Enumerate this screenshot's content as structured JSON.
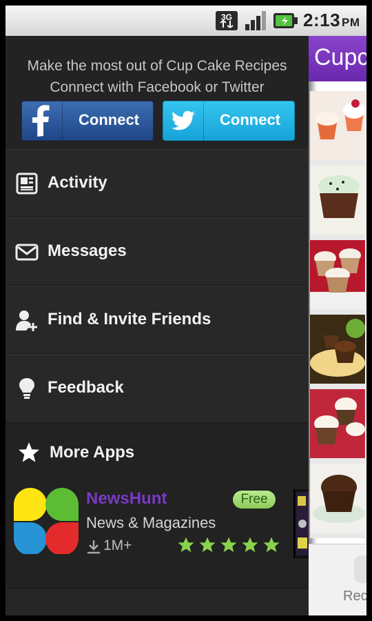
{
  "status_bar": {
    "network": "3G",
    "time": "2:13",
    "ampm": "PM"
  },
  "drawer": {
    "promo_line1": "Make the most out of Cup Cake Recipes",
    "promo_line2": "Connect with Facebook or Twitter",
    "facebook_button": "Connect",
    "twitter_button": "Connect",
    "menu": [
      {
        "label": "Activity",
        "icon": "newspaper-icon"
      },
      {
        "label": "Messages",
        "icon": "envelope-icon"
      },
      {
        "label": "Find & Invite Friends",
        "icon": "add-friend-icon"
      },
      {
        "label": "Feedback",
        "icon": "lightbulb-icon"
      }
    ],
    "more_apps": {
      "label": "More Apps",
      "app": {
        "name": "NewsHunt",
        "badge": "Free",
        "category": "News & Magazines",
        "downloads": "1M+",
        "rating": 5,
        "colors": {
          "name": "#7b39c6",
          "badge": "#9fdd6e",
          "stars": "#8ad14c"
        }
      }
    }
  },
  "main": {
    "title": "Cupc",
    "bottom_label": "Rec",
    "header_color": "#7a36bf"
  }
}
